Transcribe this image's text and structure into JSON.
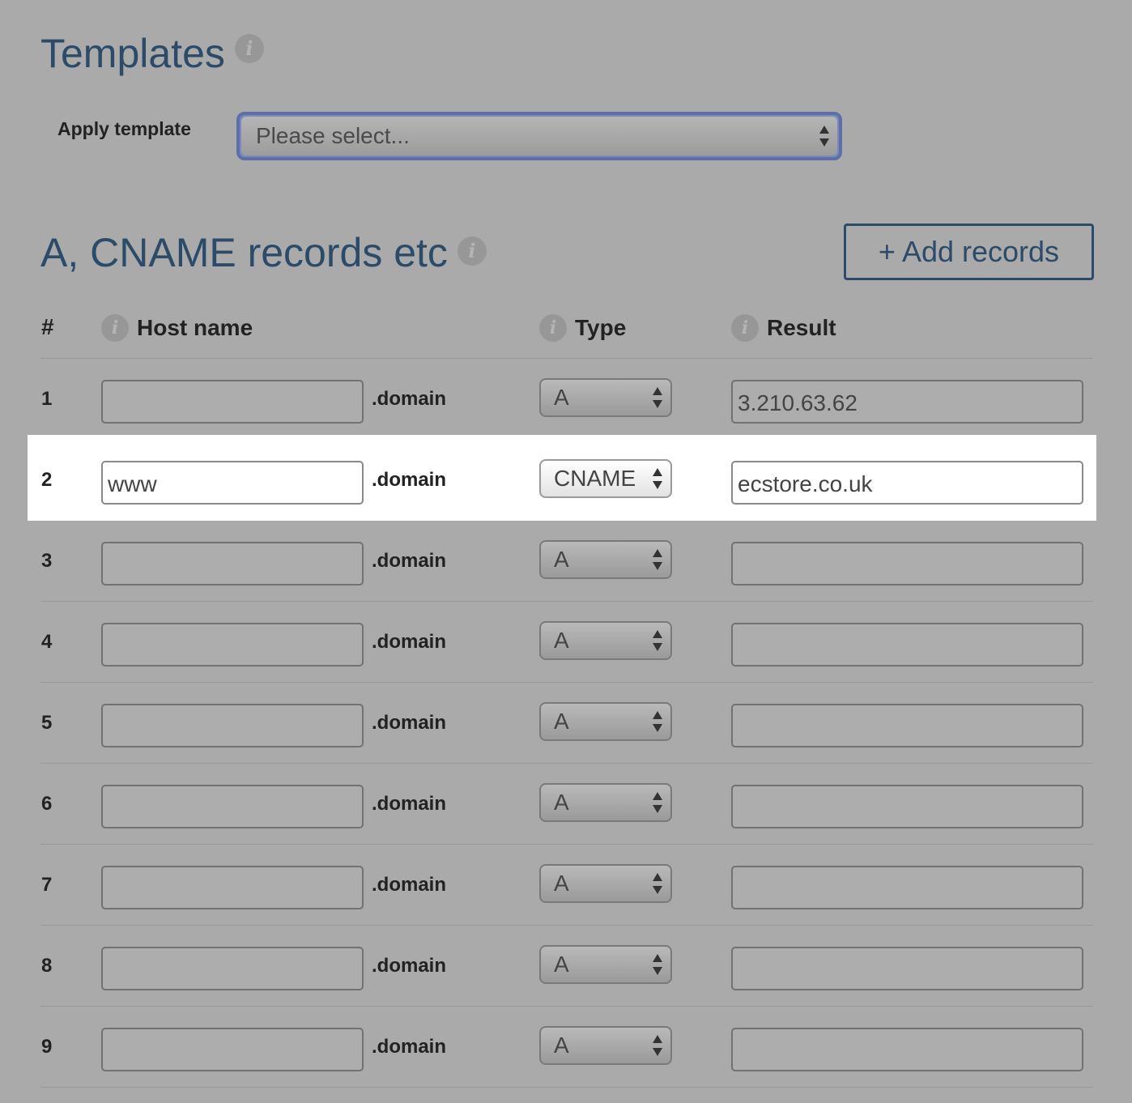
{
  "templates": {
    "title": "Templates",
    "info_icon": "i",
    "apply_label": "Apply template",
    "select_placeholder": "Please select..."
  },
  "records": {
    "title": "A, CNAME records etc",
    "info_icon": "i",
    "add_button_label": "+ Add records",
    "columns": {
      "number": "#",
      "host": "Host name",
      "type": "Type",
      "result": "Result"
    },
    "domain_suffix": ".domain",
    "rows": [
      {
        "num": "1",
        "host": "",
        "type": "A",
        "result": "3.210.63.62",
        "highlighted": false
      },
      {
        "num": "2",
        "host": "www",
        "type": "CNAME",
        "result": "ecstore.co.uk",
        "highlighted": true
      },
      {
        "num": "3",
        "host": "",
        "type": "A",
        "result": "",
        "highlighted": false
      },
      {
        "num": "4",
        "host": "",
        "type": "A",
        "result": "",
        "highlighted": false
      },
      {
        "num": "5",
        "host": "",
        "type": "A",
        "result": "",
        "highlighted": false
      },
      {
        "num": "6",
        "host": "",
        "type": "A",
        "result": "",
        "highlighted": false
      },
      {
        "num": "7",
        "host": "",
        "type": "A",
        "result": "",
        "highlighted": false
      },
      {
        "num": "8",
        "host": "",
        "type": "A",
        "result": "",
        "highlighted": false
      },
      {
        "num": "9",
        "host": "",
        "type": "A",
        "result": "",
        "highlighted": false
      }
    ]
  },
  "colors": {
    "background": "#aaaaaa",
    "heading": "#2c4b68",
    "highlight_row": "#ffffff",
    "select_focus": "#5c6fa8"
  },
  "icons": [
    "info-icon",
    "select-arrows-icon"
  ]
}
